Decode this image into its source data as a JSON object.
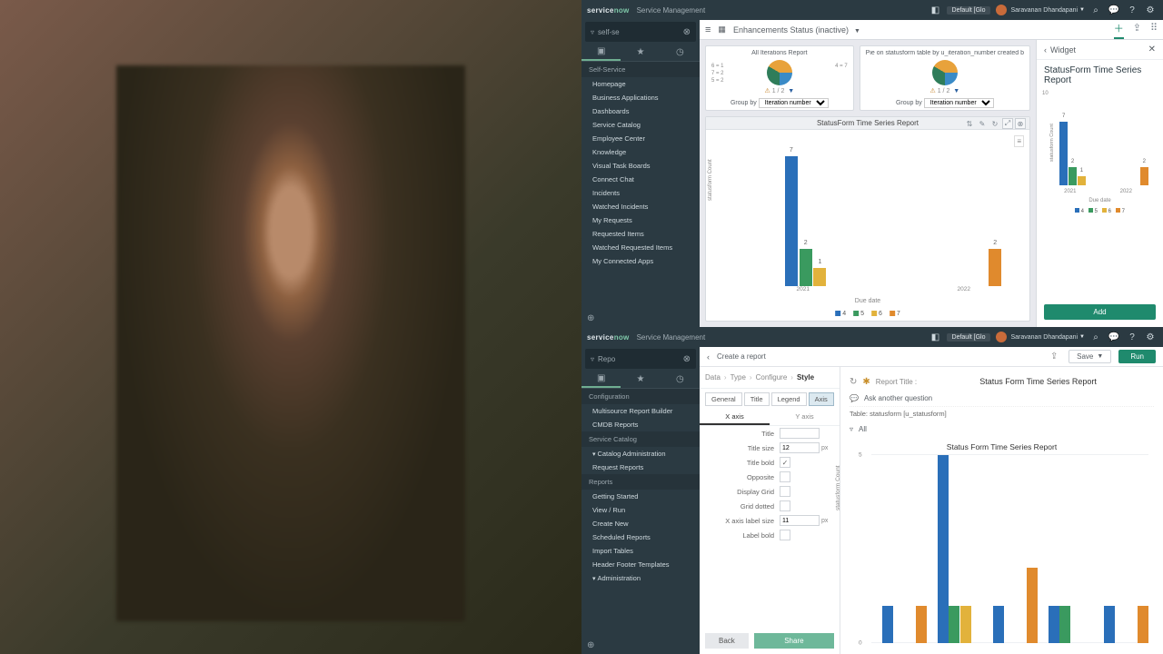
{
  "brand": {
    "name": "servicenow",
    "sub": "Service Management"
  },
  "header": {
    "pill": "Default [Glo",
    "user": "Saravanan Dhandapani"
  },
  "top": {
    "search": "self-se",
    "nav_hdr": "Self-Service",
    "nav": [
      "Homepage",
      "Business Applications",
      "Dashboards",
      "Service Catalog",
      "Employee Center",
      "Knowledge",
      "Visual Task Boards",
      "Connect Chat",
      "Incidents",
      "Watched Incidents",
      "My Requests",
      "Requested Items",
      "Watched Requested Items",
      "My Connected Apps"
    ],
    "page_title": "Enhancements Status (inactive)",
    "card1": {
      "title": "All Iterations Report",
      "labels": [
        "6 = 1",
        "7 = 2",
        "5 = 2",
        "4 = 7"
      ],
      "foot": "1 / 2",
      "group_label": "Group by",
      "group_opt": "Iteration number"
    },
    "card2": {
      "title": "Pie on statusform table by u_iteration_number created b",
      "foot": "1 / 2",
      "group_label": "Group by",
      "group_opt": "Iteration number"
    },
    "big": {
      "title": "StatusForm Time Series Report",
      "ylabel": "statusform Count",
      "xlabel": "Due date"
    },
    "widget": {
      "label": "Widget",
      "title": "StatusForm Time Series Report",
      "btn": "Add",
      "ylabel": "statusform Count",
      "xlabel": "Due date",
      "ymax": "10"
    }
  },
  "bot": {
    "search": "Repo",
    "nav": [
      {
        "t": "h",
        "l": "Configuration"
      },
      {
        "t": "i",
        "l": "Multisource Report Builder"
      },
      {
        "t": "i",
        "l": "CMDB Reports"
      },
      {
        "t": "h",
        "l": "Service Catalog"
      },
      {
        "t": "c",
        "l": "Catalog Administration"
      },
      {
        "t": "i",
        "l": "Request Reports"
      },
      {
        "t": "h",
        "l": "Reports"
      },
      {
        "t": "i",
        "l": "Getting Started"
      },
      {
        "t": "i",
        "l": "View / Run"
      },
      {
        "t": "i",
        "l": "Create New"
      },
      {
        "t": "i",
        "l": "Scheduled Reports"
      },
      {
        "t": "i",
        "l": "Import Tables"
      },
      {
        "t": "i",
        "l": "Header Footer Templates"
      },
      {
        "t": "c",
        "l": "Administration"
      }
    ],
    "page_back": "Create a report",
    "actions": {
      "save": "Save",
      "run": "Run"
    },
    "crumbs": [
      "Data",
      "Type",
      "Configure",
      "Style"
    ],
    "style_tabs": [
      "General",
      "Title",
      "Legend",
      "Axis"
    ],
    "axis_tabs": [
      "X axis",
      "Y axis"
    ],
    "form": {
      "title": "Title",
      "title_size": "Title size",
      "title_size_v": "12",
      "title_bold": "Title bold",
      "opposite": "Opposite",
      "display_grid": "Display Grid",
      "grid_dotted": "Grid dotted",
      "xlabel_size": "X axis label size",
      "xlabel_size_v": "11",
      "label_bold": "Label bold",
      "px": "px"
    },
    "foot": {
      "back": "Back",
      "share": "Share"
    },
    "right": {
      "rt_label": "Report Title :",
      "rt_value": "Status Form Time Series Report",
      "ask": "Ask another question",
      "table": "Table: statusform [u_statusform]",
      "filter": "All",
      "chart_title": "Status Form Time Series Report",
      "ylabel": "statusform Count"
    }
  },
  "chart_data": [
    {
      "id": "top_big_bar",
      "type": "bar",
      "title": "StatusForm Time Series Report",
      "xlabel": "Due date",
      "ylabel": "statusform Count",
      "ylim": [
        0,
        8
      ],
      "categories": [
        "2021",
        "2022"
      ],
      "series": [
        {
          "name": "4",
          "color": "#2a6fb9",
          "values": [
            7,
            0
          ]
        },
        {
          "name": "5",
          "color": "#3a9a5f",
          "values": [
            2,
            0
          ]
        },
        {
          "name": "6",
          "color": "#e2b23b",
          "values": [
            1,
            0
          ]
        },
        {
          "name": "7",
          "color": "#e08a2d",
          "values": [
            0,
            2
          ]
        }
      ],
      "legend": [
        "4",
        "5",
        "6",
        "7"
      ]
    },
    {
      "id": "widget_preview_bar",
      "type": "bar",
      "title": "StatusForm Time Series Report",
      "xlabel": "Due date",
      "ylabel": "statusform Count",
      "ylim": [
        0,
        10
      ],
      "categories": [
        "2021",
        "2022"
      ],
      "series": [
        {
          "name": "4",
          "color": "#2a6fb9",
          "values": [
            7,
            0
          ]
        },
        {
          "name": "5",
          "color": "#3a9a5f",
          "values": [
            2,
            0
          ]
        },
        {
          "name": "6",
          "color": "#e2b23b",
          "values": [
            1,
            0
          ]
        },
        {
          "name": "7",
          "color": "#e08a2d",
          "values": [
            0,
            2
          ]
        }
      ],
      "legend": [
        "4",
        "5",
        "6",
        "7"
      ]
    },
    {
      "id": "bottom_designer_bar",
      "type": "bar",
      "title": "Status Form Time Series Report",
      "ylabel": "statusform Count",
      "ylim": [
        0,
        5
      ],
      "groups": 5,
      "series": [
        {
          "name": "4",
          "color": "#2a6fb9",
          "values": [
            1,
            5,
            1,
            1,
            1
          ]
        },
        {
          "name": "5",
          "color": "#3a9a5f",
          "values": [
            0,
            1,
            0,
            1,
            0
          ]
        },
        {
          "name": "6",
          "color": "#e2b23b",
          "values": [
            0,
            1,
            0,
            0,
            0
          ]
        },
        {
          "name": "7",
          "color": "#e08a2d",
          "values": [
            1,
            0,
            2,
            0,
            1
          ]
        }
      ]
    },
    {
      "id": "card1_pie",
      "type": "pie",
      "title": "All Iterations Report",
      "slices": [
        {
          "label": "4",
          "value": 7
        },
        {
          "label": "5",
          "value": 2
        },
        {
          "label": "6",
          "value": 1
        },
        {
          "label": "7",
          "value": 2
        }
      ]
    },
    {
      "id": "card2_pie",
      "type": "pie",
      "title": "Pie on statusform table by u_iteration_number",
      "slices": [
        {
          "label": "4",
          "value": 7
        },
        {
          "label": "5",
          "value": 2
        },
        {
          "label": "6",
          "value": 1
        },
        {
          "label": "7",
          "value": 2
        }
      ]
    }
  ]
}
